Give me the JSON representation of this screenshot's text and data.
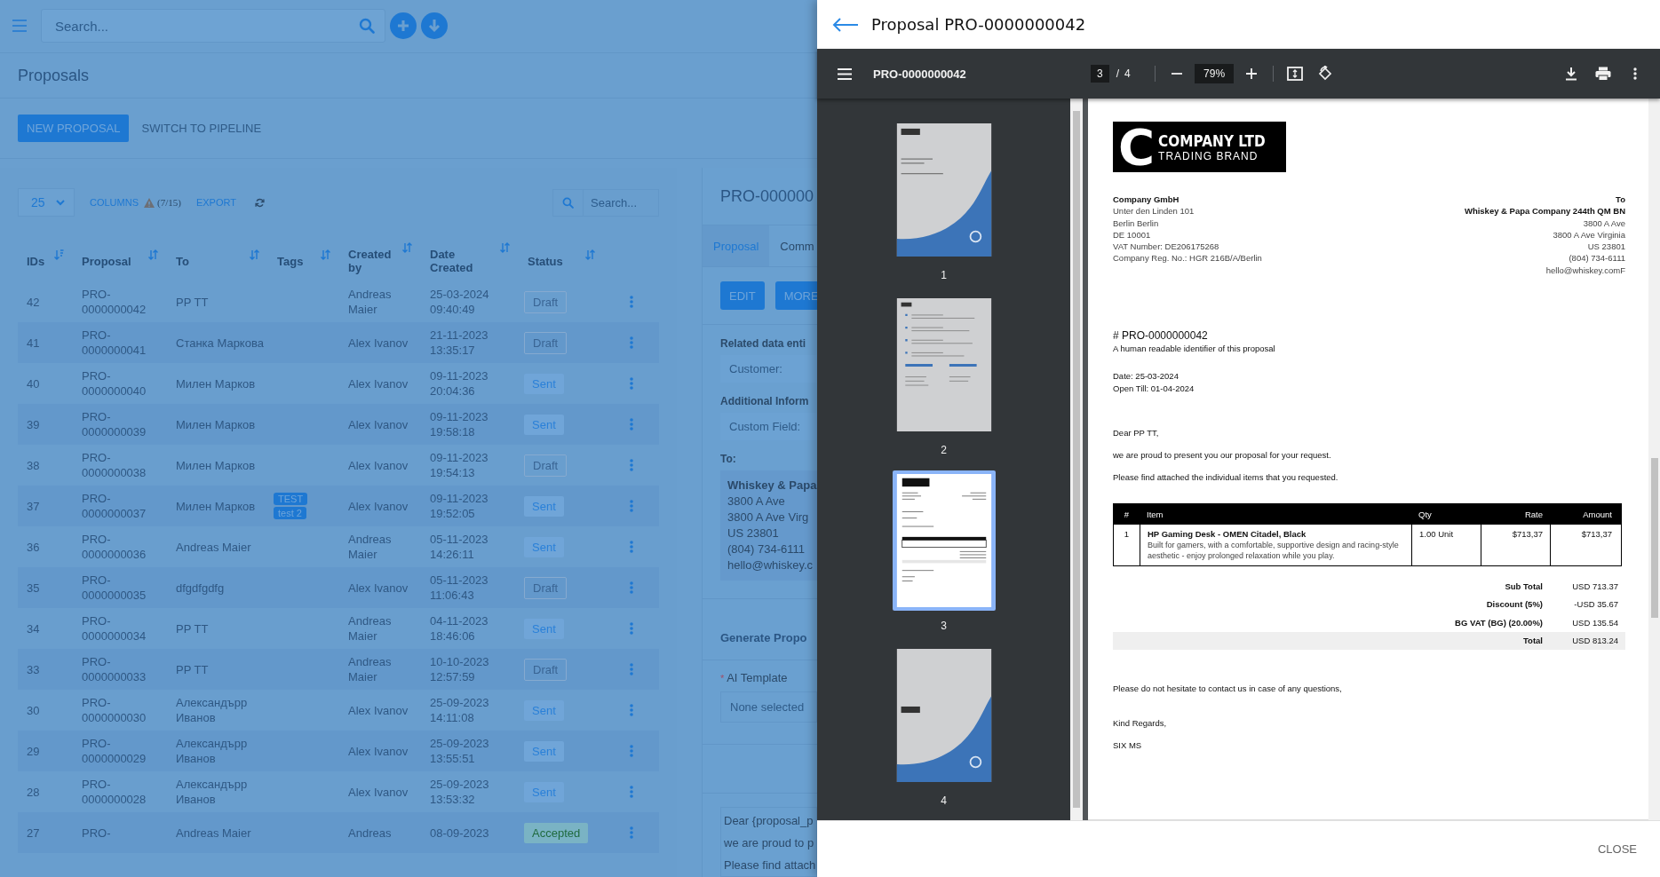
{
  "search": {
    "placeholder": "Search..."
  },
  "page_title": "Proposals",
  "actions": [
    {
      "label": "NEW PROPOSAL",
      "kind": "primary"
    },
    {
      "label": "SWITCH TO PIPELINE",
      "kind": "text"
    }
  ],
  "table_toolbar": {
    "page_size": "25",
    "columns_label": "COLUMNS",
    "columns_count": "(7/15)",
    "export_label": "EXPORT",
    "search_placeholder": "Search..."
  },
  "table": {
    "columns": [
      {
        "label": "IDs",
        "sorted": true
      },
      {
        "label": "Proposal",
        "sorted": false
      },
      {
        "label": "To",
        "sorted": false
      },
      {
        "label": "Tags",
        "sorted": false
      },
      {
        "label": "Created by",
        "sorted": false
      },
      {
        "label": "Date Created",
        "sorted": false
      },
      {
        "label": "Status",
        "sorted": false
      }
    ],
    "rows": [
      {
        "id": "42",
        "proposal": "PRO-0000000042",
        "to": "PP TT",
        "tags": [],
        "created_by": "Andreas Maier",
        "date": "25-03-2024 09:40:49",
        "status": {
          "label": "Draft",
          "kind": "draft"
        }
      },
      {
        "id": "41",
        "proposal": "PRO-0000000041",
        "to": "Станка Маркова",
        "tags": [],
        "created_by": "Alex Ivanov",
        "date": "21-11-2023 13:35:17",
        "status": {
          "label": "Draft",
          "kind": "draft"
        }
      },
      {
        "id": "40",
        "proposal": "PRO-0000000040",
        "to": "Милен Марков",
        "tags": [],
        "created_by": "Alex Ivanov",
        "date": "09-11-2023 20:04:36",
        "status": {
          "label": "Sent",
          "kind": "sent"
        }
      },
      {
        "id": "39",
        "proposal": "PRO-0000000039",
        "to": "Милен Марков",
        "tags": [],
        "created_by": "Alex Ivanov",
        "date": "09-11-2023 19:58:18",
        "status": {
          "label": "Sent",
          "kind": "sent"
        }
      },
      {
        "id": "38",
        "proposal": "PRO-0000000038",
        "to": "Милен Марков",
        "tags": [],
        "created_by": "Alex Ivanov",
        "date": "09-11-2023 19:54:13",
        "status": {
          "label": "Draft",
          "kind": "draft"
        }
      },
      {
        "id": "37",
        "proposal": "PRO-0000000037",
        "to": "Милен Марков",
        "tags": [
          "TEST",
          "test 2"
        ],
        "created_by": "Alex Ivanov",
        "date": "09-11-2023 19:52:05",
        "status": {
          "label": "Sent",
          "kind": "sent"
        }
      },
      {
        "id": "36",
        "proposal": "PRO-0000000036",
        "to": "Andreas Maier",
        "tags": [],
        "created_by": "Andreas Maier",
        "date": "05-11-2023 14:26:11",
        "status": {
          "label": "Sent",
          "kind": "sent"
        }
      },
      {
        "id": "35",
        "proposal": "PRO-0000000035",
        "to": "dfgdfgdfg",
        "tags": [],
        "created_by": "Alex Ivanov",
        "date": "05-11-2023 11:06:43",
        "status": {
          "label": "Draft",
          "kind": "draft"
        }
      },
      {
        "id": "34",
        "proposal": "PRO-0000000034",
        "to": "PP TT",
        "tags": [],
        "created_by": "Andreas Maier",
        "date": "04-11-2023 18:46:06",
        "status": {
          "label": "Sent",
          "kind": "sent"
        }
      },
      {
        "id": "33",
        "proposal": "PRO-0000000033",
        "to": "PP TT",
        "tags": [],
        "created_by": "Andreas Maier",
        "date": "10-10-2023 12:57:59",
        "status": {
          "label": "Draft",
          "kind": "draft"
        }
      },
      {
        "id": "30",
        "proposal": "PRO-0000000030",
        "to": "Александърр Иванов",
        "tags": [],
        "created_by": "Alex Ivanov",
        "date": "25-09-2023 14:11:08",
        "status": {
          "label": "Sent",
          "kind": "sent"
        }
      },
      {
        "id": "29",
        "proposal": "PRO-0000000029",
        "to": "Александърр Иванов",
        "tags": [],
        "created_by": "Alex Ivanov",
        "date": "25-09-2023 13:55:51",
        "status": {
          "label": "Sent",
          "kind": "sent"
        }
      },
      {
        "id": "28",
        "proposal": "PRO-0000000028",
        "to": "Александърр Иванов",
        "tags": [],
        "created_by": "Alex Ivanov",
        "date": "25-09-2023 13:53:32",
        "status": {
          "label": "Sent",
          "kind": "sent"
        }
      },
      {
        "id": "27",
        "proposal": "PRO-",
        "to": "Andreas Maier",
        "tags": [],
        "created_by": "Andreas",
        "date": "08-09-2023",
        "status": {
          "label": "Accepted",
          "kind": "accepted"
        }
      }
    ]
  },
  "detail": {
    "title": "PRO-000000",
    "tabs": [
      {
        "label": "Proposal",
        "selected": true
      },
      {
        "label": "Comm",
        "selected": false
      }
    ],
    "buttons": [
      "EDIT",
      "MORE"
    ],
    "related_heading": "Related data enti",
    "customer_label": "Customer:",
    "additional_heading": "Additional Inform",
    "custom_field_label": "Custom Field:",
    "to_heading": "To:",
    "to_name": "Whiskey & Papa",
    "to_lines": [
      "3800 A Ave",
      "3800 A Ave Virg",
      "US 23801",
      "(804) 734-6111",
      "hello@whiskey.c"
    ],
    "generate_heading": "Generate Propo",
    "template_required_mark": "*",
    "template_label": "AI Template",
    "template_placeholder": "None selected",
    "body_lines": [
      "Dear {proposal_p",
      "we are proud to p",
      "Please find attach"
    ]
  },
  "modal": {
    "title": "Proposal PRO-0000000042",
    "close_label": "CLOSE",
    "viewer": {
      "file_name": "PRO-0000000042",
      "page": "3",
      "page_separator": "/",
      "page_count": "4",
      "zoom": "79%",
      "thumbnails": [
        {
          "label": "1",
          "kind": "cover",
          "selected": false
        },
        {
          "label": "2",
          "kind": "list",
          "selected": false
        },
        {
          "label": "3",
          "kind": "proposal",
          "selected": true
        },
        {
          "label": "4",
          "kind": "back",
          "selected": false
        }
      ],
      "document": {
        "logo": {
          "letter": "C",
          "name": "COMPANY LTD",
          "tagline": "TRADING BRAND"
        },
        "from": {
          "name": "Company GmbH",
          "lines": [
            "Unter den Linden 101",
            "Berlin Berlin",
            "DE 10001",
            "VAT Number: DE206175268",
            "Company Reg. No.: HGR 216B/A/Berlin"
          ]
        },
        "to": {
          "heading": "To",
          "name": "Whiskey & Papa Company 244th QM BN",
          "lines": [
            "3800 A Ave",
            "3800 A Ave Virginia",
            "US 23801",
            "(804) 734-6111",
            "hello@whiskey.comF"
          ]
        },
        "number": "# PRO-0000000042",
        "number_note": "A human readable identifier of this proposal",
        "dates": [
          "Date: 25-03-2024",
          "Open Till: 01-04-2024"
        ],
        "greeting": "Dear PP TT,",
        "paragraphs": [
          "we are proud to present you our proposal for your request.",
          "Please find attached the individual items that you requested."
        ],
        "items_table": {
          "columns": [
            "#",
            "Item",
            "Qty",
            "Rate",
            "Amount"
          ],
          "rows": [
            {
              "number": "1",
              "name": "HP Gaming Desk - OMEN Citadel, Black",
              "description": "Built for gamers, with a comfortable, supportive design and racing-style aesthetic - enjoy prolonged relaxation while you play.",
              "qty": "1.00 Unit",
              "rate": "$713,37",
              "amount": "$713,37"
            }
          ]
        },
        "totals": [
          {
            "label": "Sub Total",
            "value": "USD 713.37",
            "highlighted": false
          },
          {
            "label": "Discount (5%)",
            "value": "-USD 35.67",
            "highlighted": false
          },
          {
            "label": "BG VAT (BG) (20.00%)",
            "value": "USD 135.54",
            "highlighted": false
          },
          {
            "label": "Total",
            "value": "USD 813.24",
            "highlighted": true
          }
        ],
        "closing": "Please do not hesitate to contact us in case of any questions,",
        "regards": "Kind Regards,",
        "signature": "SIX MS"
      }
    }
  }
}
